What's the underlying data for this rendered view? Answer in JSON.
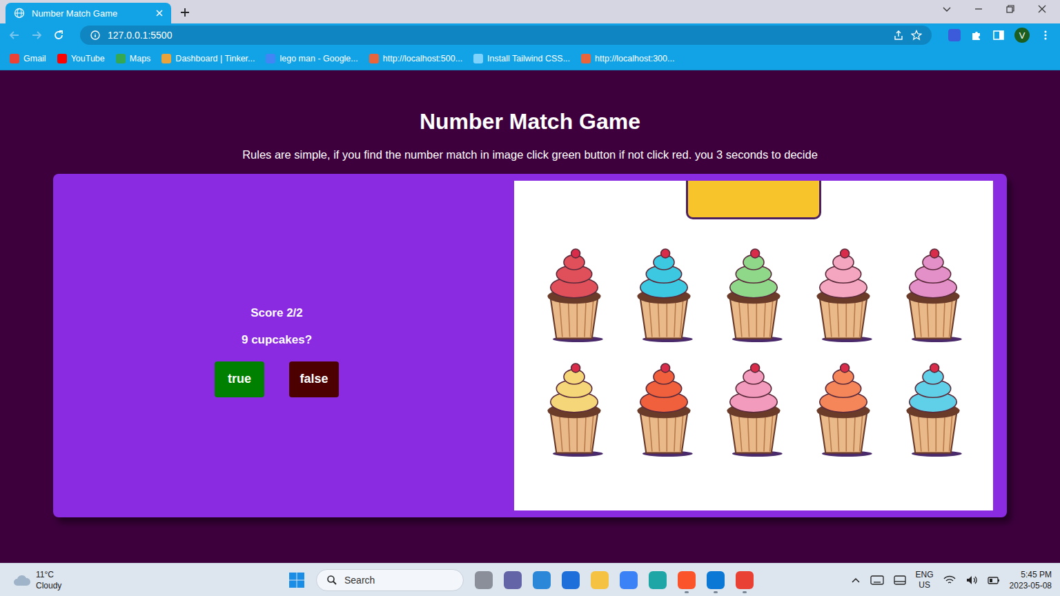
{
  "browser": {
    "tab": {
      "title": "Number Match Game"
    },
    "address": "127.0.0.1:5500",
    "profile": "V",
    "bookmarks": [
      {
        "label": "Gmail",
        "color": "#ea4335"
      },
      {
        "label": "YouTube",
        "color": "#ff0000"
      },
      {
        "label": "Maps",
        "color": "#34a853"
      },
      {
        "label": "Dashboard | Tinker...",
        "color": "#e8a33d"
      },
      {
        "label": "lego man - Google...",
        "color": "#4285f4"
      },
      {
        "label": "http://localhost:500...",
        "color": "#e8643a"
      },
      {
        "label": "Install Tailwind CSS...",
        "color": "#7dd3fc"
      },
      {
        "label": "http://localhost:300...",
        "color": "#e8643a"
      }
    ]
  },
  "page": {
    "title": "Number Match Game",
    "rules": "Rules are simple, if you find the number match in image click green button if not click red. you 3 seconds to decide",
    "score": "Score 2/2",
    "question": "9 cupcakes?",
    "buttons": [
      {
        "label": "true",
        "color": "#008000"
      },
      {
        "label": "false",
        "color": "#4d0000"
      }
    ]
  },
  "taskbar": {
    "weather": {
      "temp": "11°C",
      "condition": "Cloudy"
    },
    "search": "Search",
    "apps": [
      {
        "color": "#8a8f99",
        "running": false
      },
      {
        "color": "#6264a7",
        "running": false
      },
      {
        "color": "#2b88d8",
        "running": false
      },
      {
        "color": "#1e6fd9",
        "running": false
      },
      {
        "color": "#f5c242",
        "running": false
      },
      {
        "color": "#3b82f6",
        "running": false
      },
      {
        "color": "#1ea6a6",
        "running": false
      },
      {
        "color": "#fb542b",
        "running": true
      },
      {
        "color": "#0a78d4",
        "running": true
      },
      {
        "color": "#e94235",
        "running": true
      }
    ],
    "language": [
      "ENG",
      "US"
    ],
    "time": "5:45 PM",
    "date": "2023-05-08"
  }
}
